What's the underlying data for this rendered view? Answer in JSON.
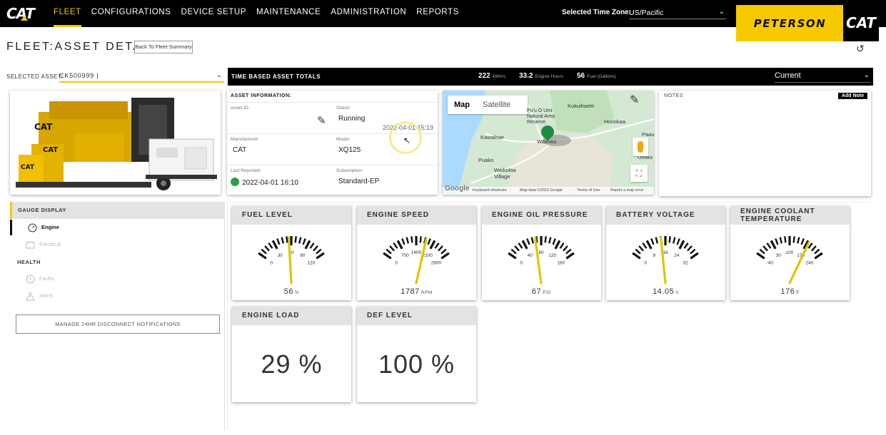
{
  "brand": {
    "logo_text": "CAT",
    "dealer_name": "PETERSON",
    "dealer_cat": "CAT"
  },
  "nav": [
    "FLEET",
    "CONFIGURATIONS",
    "DEVICE SETUP",
    "MAINTENANCE",
    "ADMINISTRATION",
    "REPORTS"
  ],
  "active_nav": "FLEET",
  "timezone": {
    "label": "Selected Time Zone:",
    "value": "US/Pacific"
  },
  "page": {
    "title": "FLEET:ASSET DETAIL",
    "back_label": "Back To Fleet Summary"
  },
  "selected_asset": {
    "label": "SELECTED ASSET:",
    "value": "CK500999 |"
  },
  "totals": {
    "label": "TIME BASED ASSET TOTALS",
    "kwhrs": "222",
    "kwhrs_unit": "kWhrs",
    "engine_hours": "33.2",
    "engine_hours_unit": "Engine Hours",
    "fuel": "56",
    "fuel_unit": "Fuel (Gallons)",
    "period": "Current"
  },
  "asset_info": {
    "header": "ASSET INFORMATION:",
    "asset_id_label": "Asset ID:",
    "asset_id": "",
    "status_label": "Status:",
    "status": "Running",
    "status_time": "2022-04-01 15:19",
    "manufacturer_label": "Manufacturer:",
    "manufacturer": "CAT",
    "model_label": "Model:",
    "model": "XQ125",
    "last_reported_label": "Last Reported:",
    "last_reported": "2022-04-01 16:10",
    "subscription_label": "Subscription:",
    "subscription": "Standard-EP"
  },
  "map": {
    "tab_map": "Map",
    "tab_satellite": "Satellite",
    "places": [
      "Kukuihaele",
      "Pu'u O Umi Natural Area Reserve",
      "Honokaa",
      "Paau",
      "Kawaihae",
      "Waimea",
      "Puako",
      "Waikoloa Village",
      "Umiko"
    ],
    "footer_shortcuts": "Keyboard shortcuts",
    "footer_data": "Map data ©2022 Google",
    "footer_terms": "Terms of Use",
    "footer_report": "Report a map error",
    "google": "Google"
  },
  "notes": {
    "title": "NOTES",
    "add_label": "Add Note"
  },
  "side": {
    "gauge_display": "GAUGE DISPLAY",
    "engine": "Engine",
    "electrical": "Electrical",
    "health": "HEALTH",
    "faults": "Faults",
    "alerts": "Alerts",
    "manage": "MANAGE 24HR DISCONNECT NOTIFICATIONS"
  },
  "gauges": [
    {
      "title": "FUEL LEVEL",
      "ticks": [
        "0",
        "30",
        "60",
        "90",
        "120"
      ],
      "min": 0,
      "max": 120,
      "value": 56,
      "display": "56",
      "unit": "%"
    },
    {
      "title": "ENGINE SPEED",
      "ticks": [
        "0",
        "700",
        "1400",
        "2100",
        "2800"
      ],
      "min": 0,
      "max": 2800,
      "value": 1787,
      "display": "1787",
      "unit": "RPM"
    },
    {
      "title": "ENGINE OIL PRESSURE",
      "ticks": [
        "0",
        "40",
        "80",
        "120",
        "160"
      ],
      "min": 0,
      "max": 160,
      "value": 67,
      "display": "67",
      "unit": "PSI"
    },
    {
      "title": "BATTERY VOLTAGE",
      "ticks": [
        "0",
        "8",
        "16",
        "24",
        "32"
      ],
      "min": 0,
      "max": 32,
      "value": 14.05,
      "display": "14.05",
      "unit": "V"
    },
    {
      "title": "ENGINE COOLANT TEMPERATURE",
      "ticks": [
        "-40",
        "30",
        "100",
        "170",
        "240"
      ],
      "min": -40,
      "max": 240,
      "value": 176,
      "display": "176",
      "unit": "F"
    }
  ],
  "engine_load": {
    "title": "ENGINE LOAD",
    "value": "29 %"
  },
  "def_level": {
    "title": "DEF LEVEL",
    "value": "100 %"
  },
  "colors": {
    "accent": "#f7c900",
    "needle": "#e0c400",
    "green": "#1e8e3e"
  }
}
